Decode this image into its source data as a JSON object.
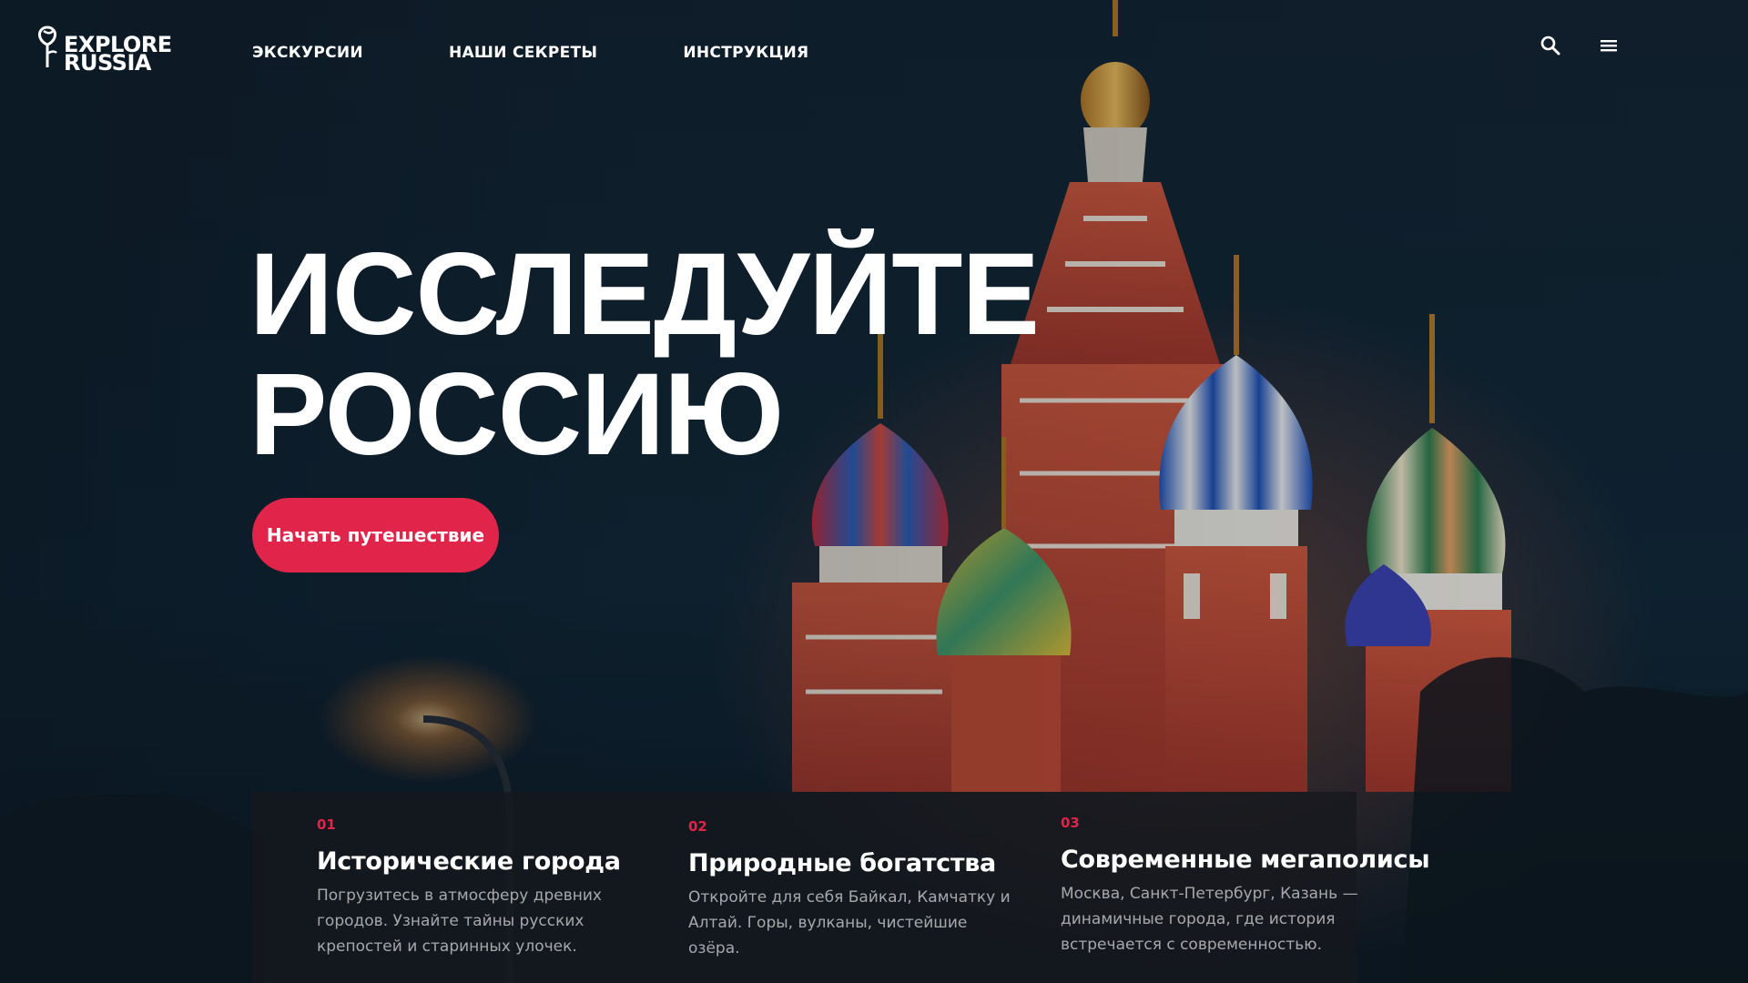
{
  "header": {
    "logo_line1": "EXPLORE",
    "logo_line2": "RUSSIA",
    "nav": [
      "ЭКСКУРСИИ",
      "НАШИ СЕКРЕТЫ",
      "ИНСТРУКЦИЯ"
    ],
    "icons": [
      "search-icon",
      "menu-icon"
    ]
  },
  "hero": {
    "title_line1": "ИССЛЕДУЙТЕ",
    "title_line2": "РОССИЮ",
    "cta_label": "Начать путешествие",
    "background": "st-basils-cathedral-night-photo"
  },
  "features": [
    {
      "num": "01",
      "title": "Исторические города",
      "desc": "Погрузитесь в атмосферу древних городов. Узнайте тайны русских крепостей и старинных улочек."
    },
    {
      "num": "02",
      "title": "Природные богатства",
      "desc": "Откройте для себя Байкал, Камчатку и Алтай. Горы, вулканы, чистейшие озёра."
    },
    {
      "num": "03",
      "title": "Современные мегаполисы",
      "desc": "Москва, Санкт-Петербург, Казань — динамичные города, где история встречается с современностью."
    }
  ],
  "colors": {
    "accent": "#e0244a",
    "text": "#ffffff",
    "panel": "#16181e"
  }
}
